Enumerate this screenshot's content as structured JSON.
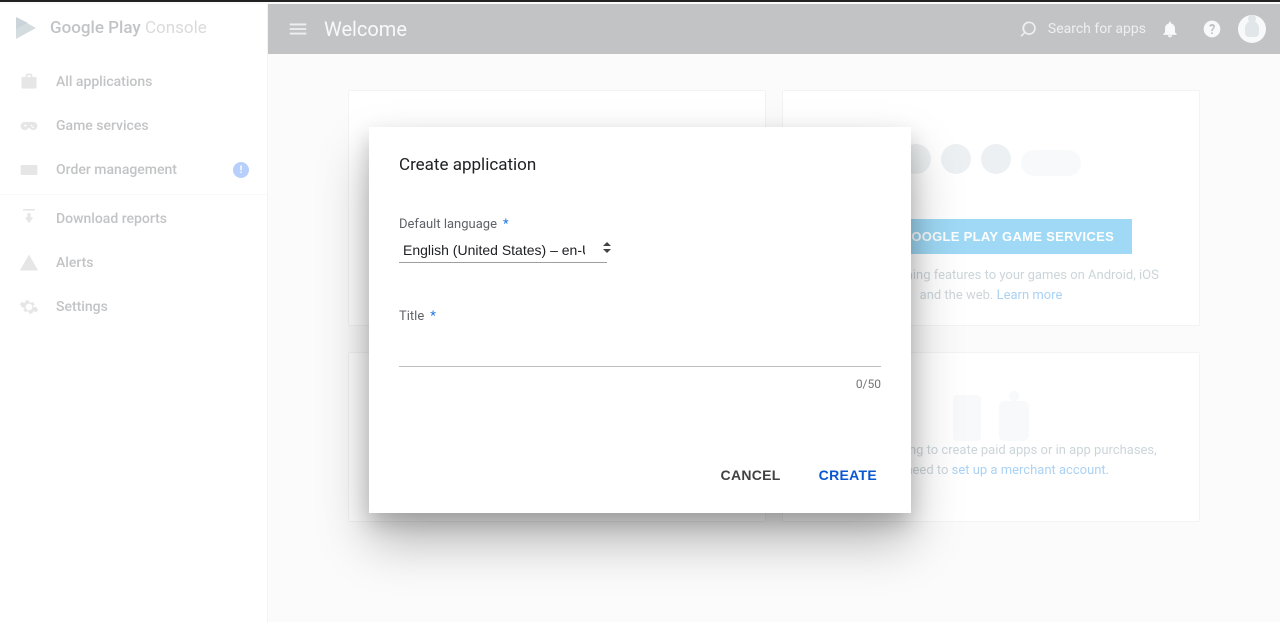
{
  "brand": {
    "strong": "Google Play",
    "light": " Console"
  },
  "header": {
    "title": "Welcome",
    "search_placeholder": "Search for apps"
  },
  "sidebar": {
    "items": [
      {
        "label": "All applications"
      },
      {
        "label": "Game services"
      },
      {
        "label": "Order management",
        "badge": "!"
      },
      {
        "label": "Download reports"
      },
      {
        "label": "Alerts"
      },
      {
        "label": "Settings"
      }
    ]
  },
  "cards": {
    "game_services": {
      "cta": "ADD GOOGLE PLAY GAME SERVICES",
      "desc": "Add social gaming features to your games on Android, iOS and the web. ",
      "link": "Learn more"
    },
    "merchant": {
      "desc": "If you're planning to create paid apps or in app purchases, you'll need to ",
      "link": "set up a merchant account."
    }
  },
  "dialog": {
    "title": "Create application",
    "lang_label": "Default language",
    "lang_value": "English (United States) – en-US",
    "title_label": "Title",
    "title_value": "",
    "counter": "0/50",
    "cancel": "CANCEL",
    "create": "CREATE"
  }
}
